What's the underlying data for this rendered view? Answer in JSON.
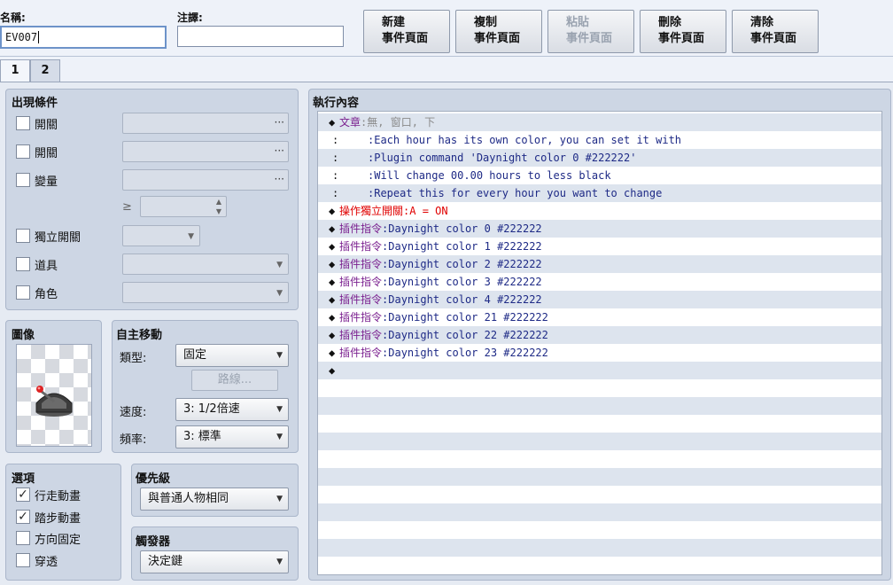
{
  "header": {
    "name_label": "名稱:",
    "name_value": "EV007",
    "note_label": "注譯:",
    "note_value": ""
  },
  "buttons": [
    {
      "line1": "新建",
      "line2": "事件頁面",
      "enabled": true
    },
    {
      "line1": "複制",
      "line2": "事件頁面",
      "enabled": true
    },
    {
      "line1": "粘貼",
      "line2": "事件頁面",
      "enabled": false
    },
    {
      "line1": "刪除",
      "line2": "事件頁面",
      "enabled": true
    },
    {
      "line1": "清除",
      "line2": "事件頁面",
      "enabled": true
    }
  ],
  "tabs": [
    "1",
    "2"
  ],
  "conditions": {
    "title": "出現條件",
    "items": [
      {
        "label": "開關",
        "checked": false
      },
      {
        "label": "開關",
        "checked": false
      },
      {
        "label": "變量",
        "checked": false
      },
      {
        "label": "獨立開關",
        "checked": false
      },
      {
        "label": "道具",
        "checked": false
      },
      {
        "label": "角色",
        "checked": false
      }
    ],
    "gte_symbol": "≥",
    "ellipsis": "···"
  },
  "image": {
    "title": "圖像"
  },
  "autonomous": {
    "title": "自主移動",
    "type_label": "類型:",
    "type_value": "固定",
    "route_button": "路線...",
    "speed_label": "速度:",
    "speed_value": "3: 1/2倍速",
    "freq_label": "頻率:",
    "freq_value": "3: 標準"
  },
  "options": {
    "title": "選項",
    "items": [
      {
        "label": "行走動畫",
        "checked": true
      },
      {
        "label": "踏步動畫",
        "checked": true
      },
      {
        "label": "方向固定",
        "checked": false
      },
      {
        "label": "穿透",
        "checked": false
      }
    ]
  },
  "priority": {
    "title": "優先級",
    "value": "與普通人物相同"
  },
  "trigger": {
    "title": "觸發器",
    "value": "決定鍵"
  },
  "contents": {
    "title": "執行內容",
    "lines": [
      {
        "marker": "◆",
        "head": "文章",
        "sep": ":",
        "body": "無, 窗口, 下",
        "head_color": "purple",
        "body_color": "gray"
      },
      {
        "marker": ":",
        "head": "",
        "sep": ":",
        "body": "Each hour has its own color, you can set it with",
        "head_color": "navy",
        "body_color": "navy"
      },
      {
        "marker": ":",
        "head": "",
        "sep": ":",
        "body": "Plugin command 'Daynight color 0 #222222'",
        "head_color": "navy",
        "body_color": "navy"
      },
      {
        "marker": ":",
        "head": "",
        "sep": ":",
        "body": "Will change 00.00 hours to less black",
        "head_color": "navy",
        "body_color": "navy"
      },
      {
        "marker": ":",
        "head": "",
        "sep": ":",
        "body": "Repeat this for every hour you want to change",
        "head_color": "navy",
        "body_color": "navy"
      },
      {
        "marker": "◆",
        "head": "操作獨立開關",
        "sep": ":",
        "body": "A = ON",
        "head_color": "red",
        "body_color": "red"
      },
      {
        "marker": "◆",
        "head": "插件指令",
        "sep": ":",
        "body": "Daynight color 0 #222222",
        "head_color": "purple",
        "body_color": "navy"
      },
      {
        "marker": "◆",
        "head": "插件指令",
        "sep": ":",
        "body": "Daynight color 1 #222222",
        "head_color": "purple",
        "body_color": "navy"
      },
      {
        "marker": "◆",
        "head": "插件指令",
        "sep": ":",
        "body": "Daynight color 2 #222222",
        "head_color": "purple",
        "body_color": "navy"
      },
      {
        "marker": "◆",
        "head": "插件指令",
        "sep": ":",
        "body": "Daynight color 3 #222222",
        "head_color": "purple",
        "body_color": "navy"
      },
      {
        "marker": "◆",
        "head": "插件指令",
        "sep": ":",
        "body": "Daynight color 4 #222222",
        "head_color": "purple",
        "body_color": "navy"
      },
      {
        "marker": "◆",
        "head": "插件指令",
        "sep": ":",
        "body": "Daynight color 21 #222222",
        "head_color": "purple",
        "body_color": "navy"
      },
      {
        "marker": "◆",
        "head": "插件指令",
        "sep": ":",
        "body": "Daynight color 22 #222222",
        "head_color": "purple",
        "body_color": "navy"
      },
      {
        "marker": "◆",
        "head": "插件指令",
        "sep": ":",
        "body": "Daynight color 23 #222222",
        "head_color": "purple",
        "body_color": "navy"
      },
      {
        "marker": "◆",
        "head": "",
        "sep": "",
        "body": "",
        "head_color": "navy",
        "body_color": "navy"
      }
    ],
    "total_rows": 26
  },
  "colors": {
    "navy": "#1e2a86",
    "purple": "#7a1f8f",
    "red": "#e00000",
    "gray": "#8a8a8a",
    "panel": "#cdd6e4",
    "row_alt": "#dde4ee"
  }
}
